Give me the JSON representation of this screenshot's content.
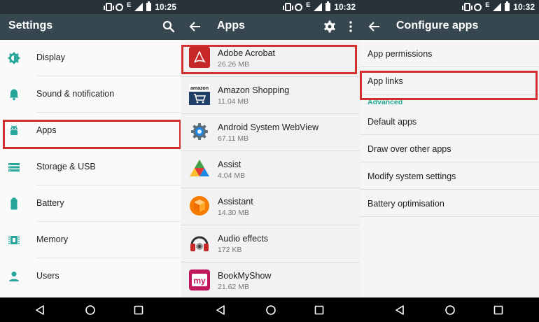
{
  "colors": {
    "status_bar": "#263238",
    "app_bar": "#37474f",
    "teal_icons": "#26a69a",
    "highlight": "#d32f2f",
    "nav_bar": "#000000"
  },
  "panels": {
    "settings": {
      "status_time": "10:25",
      "network_label": "E",
      "title": "Settings",
      "items": [
        {
          "label": "Display",
          "icon": "brightness-icon"
        },
        {
          "label": "Sound & notification",
          "icon": "bell-icon"
        },
        {
          "label": "Apps",
          "icon": "android-icon"
        },
        {
          "label": "Storage & USB",
          "icon": "storage-icon"
        },
        {
          "label": "Battery",
          "icon": "battery-icon"
        },
        {
          "label": "Memory",
          "icon": "memory-icon"
        },
        {
          "label": "Users",
          "icon": "person-icon"
        }
      ]
    },
    "apps": {
      "status_time": "10:32",
      "network_label": "E",
      "title": "Apps",
      "items": [
        {
          "name": "Adobe Acrobat",
          "size": "26.26 MB",
          "icon": "adobe-acrobat-icon"
        },
        {
          "name": "Amazon Shopping",
          "size": "11.04 MB",
          "icon": "amazon-icon"
        },
        {
          "name": "Android System WebView",
          "size": "67.11 MB",
          "icon": "webview-gear-icon"
        },
        {
          "name": "Assist",
          "size": "4.04 MB",
          "icon": "assist-triangle-icon"
        },
        {
          "name": "Assistant",
          "size": "14.30 MB",
          "icon": "assistant-cube-icon"
        },
        {
          "name": "Audio effects",
          "size": "172 KB",
          "icon": "headphones-icon"
        },
        {
          "name": "BookMyShow",
          "size": "21.62 MB",
          "icon": "bookmyshow-icon"
        }
      ],
      "icon_text": {
        "amazon": "amazon",
        "bookmyshow": "my"
      }
    },
    "configure": {
      "status_time": "10:32",
      "network_label": "E",
      "title": "Configure apps",
      "items_top": [
        "App permissions",
        "App links"
      ],
      "section_header": "Advanced",
      "items_advanced": [
        "Default apps",
        "Draw over other apps",
        "Modify system settings",
        "Battery optimisation"
      ]
    }
  }
}
